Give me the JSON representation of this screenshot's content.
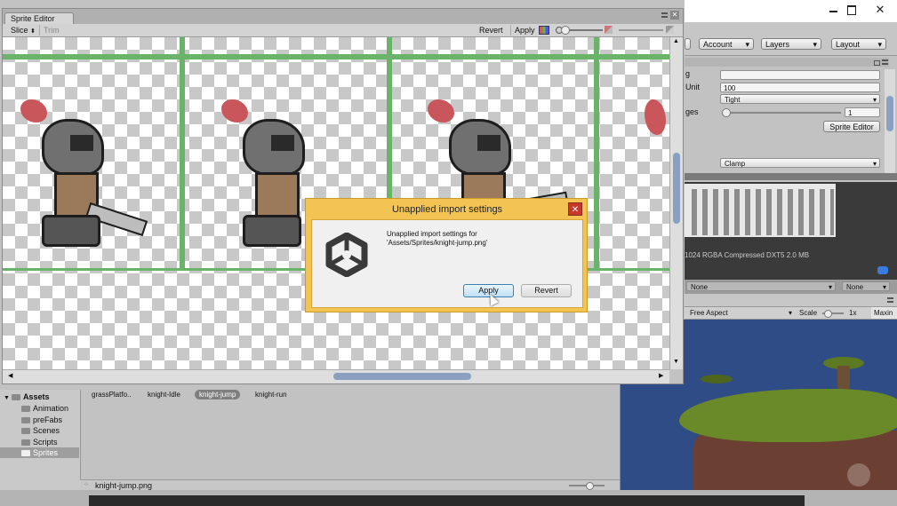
{
  "editor": {
    "title": "Sprite Editor",
    "slice_label": "Slice",
    "trim_label": "Trim",
    "revert_label": "Revert",
    "apply_label": "Apply"
  },
  "toolbar": {
    "account_label": "Account",
    "layers_label": "Layers",
    "layout_label": "Layout"
  },
  "inspector": {
    "row1_label": "g",
    "row2_label": "Unit",
    "pixels_per_unit": "100",
    "mesh_type": "Tight",
    "row4_label": "ges",
    "extrude_value": "1",
    "sprite_editor_button": "Sprite Editor",
    "wrap_mode": "Clamp",
    "preview_info": "1024  RGBA Compressed DXT5   2.0 MB",
    "dropdown_a": "None",
    "dropdown_b": "None"
  },
  "game_view": {
    "aspect": "Free Aspect",
    "scale_label": "Scale",
    "scale_value": "1x",
    "maximize_label": "Maxin"
  },
  "dialog": {
    "title": "Unapplied import settings",
    "message_line1": "Unapplied import settings for",
    "message_line2": "'Assets/Sprites/knight-jump.png'",
    "apply_label": "Apply",
    "revert_label": "Revert"
  },
  "project": {
    "root": "Assets",
    "folders": [
      "Animation",
      "preFabs",
      "Scenes",
      "Scripts",
      "Sprites"
    ],
    "assets": [
      "grassPlatfo..",
      "knight-Idle",
      "knight-jump",
      "knight-run"
    ],
    "footer_file": "knight-jump.png"
  },
  "colors": {
    "slice_grid": "#69b469",
    "dialog_frame": "#f3c453",
    "sky": "#2f4c87",
    "grass": "#6a8a2a"
  }
}
